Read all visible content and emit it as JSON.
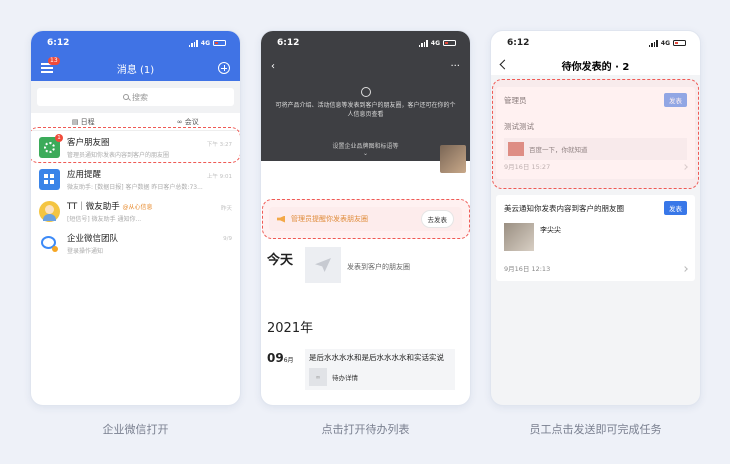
{
  "captions": [
    "企业微信打开",
    "点击打开待办列表",
    "员工点击发送即可完成任务"
  ],
  "status": {
    "time": "6:12",
    "network": "4G"
  },
  "phone1": {
    "title": "消息 (1)",
    "menu_badge": "13",
    "search_placeholder": "搜索",
    "tabs": [
      {
        "icon": "calendar-icon",
        "label": "日程"
      },
      {
        "icon": "meeting-icon",
        "label": "会议"
      }
    ],
    "chats": [
      {
        "name": "客户朋友圈",
        "preview": "管理员通知你发表内容到客户的朋友圈",
        "time": "下午 3:27",
        "badge": "1",
        "icon": "moments-icon"
      },
      {
        "name": "应用提醒",
        "preview": "微友助手: [数据日报] 客户数据 昨日客户总数:73...",
        "time": "上午 9:01",
        "icon": "apps-icon"
      },
      {
        "name": "TT｜微友助手",
        "tag": "@从心信息",
        "preview": "[短信号] 微友助手 通知你...",
        "time": "昨天",
        "icon": "person-avatar"
      },
      {
        "name": "企业微信团队",
        "preview": "登录操作通知",
        "time": "9/9",
        "icon": "wecom-team-icon"
      }
    ]
  },
  "phone2": {
    "description": "可将产品介绍、活动信息等发表到客户的朋友圈，客户还可在你的个人信息页查看",
    "brand_link": "设置企业品牌图和标语等",
    "banner_text": "管理员提醒你发表朋友圈",
    "banner_button": "去发表",
    "today_label": "今天",
    "publish_placeholder": "发表到客户的朋友圈",
    "year_label": "2021年",
    "day": "09",
    "month": "6月",
    "entry_text": "是后水水水水和是后水水水水和实话实说",
    "entry_link": "待办详情"
  },
  "phone3": {
    "title": "待你发表的 · 2",
    "card1": {
      "sender": "管理员",
      "button": "发表",
      "content": "测试测试",
      "link_text": "百度一下，你就知道",
      "time": "9月16日 15:27"
    },
    "card2": {
      "sender": "美云通知你发表内容到客户的朋友圈",
      "button": "发表",
      "author": "李尖尖",
      "time": "9月16日 12:13"
    }
  },
  "colors": {
    "accent": "#4073e5",
    "highlight": "#ef5a55",
    "publish_blue": "#3877e8"
  }
}
